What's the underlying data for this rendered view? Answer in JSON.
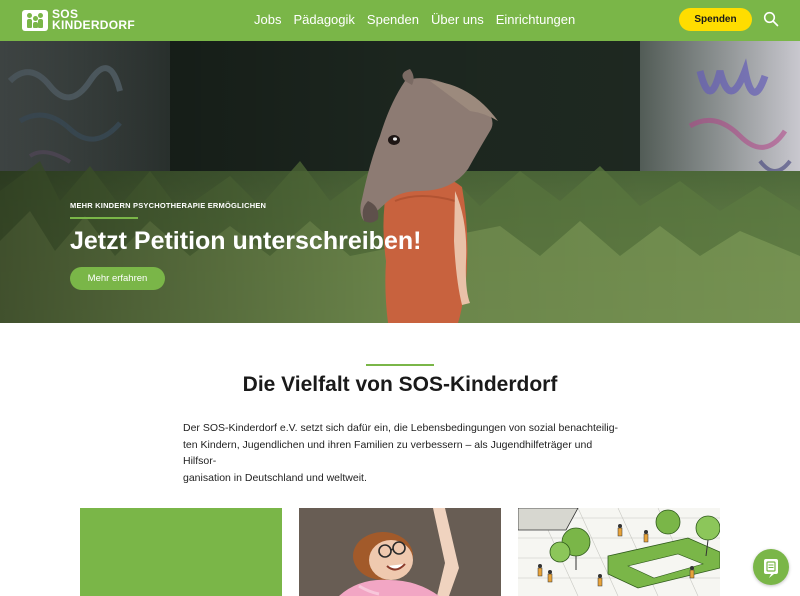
{
  "header": {
    "logo_line1": "SOS",
    "logo_line2": "KINDERDORF",
    "nav": [
      "Jobs",
      "Pädagogik",
      "Spenden",
      "Über uns",
      "Einrichtungen"
    ],
    "donate_label": "Spenden",
    "brand_color": "#7ab648",
    "donate_color": "#ffdd00",
    "search_icon": "search-icon"
  },
  "hero": {
    "kicker": "MEHR KINDERN PSYCHOTHERAPIE ERMÖGLICHEN",
    "title": "Jetzt Petition unterschreiben!",
    "button_label": "Mehr erfahren"
  },
  "intro": {
    "title": "Die Vielfalt von SOS-Kinderdorf",
    "text": "Der SOS-Kinderdorf e.V. setzt sich dafür ein, die Lebensbedingungen von sozial benachteilig-\nten Kindern, Jugendlichen und ihren Familien zu verbessern – als Jugendhilfeträger und Hilfsor-\nganisation in Deutschland und weltweit."
  },
  "chat": {
    "icon": "chat-icon"
  }
}
